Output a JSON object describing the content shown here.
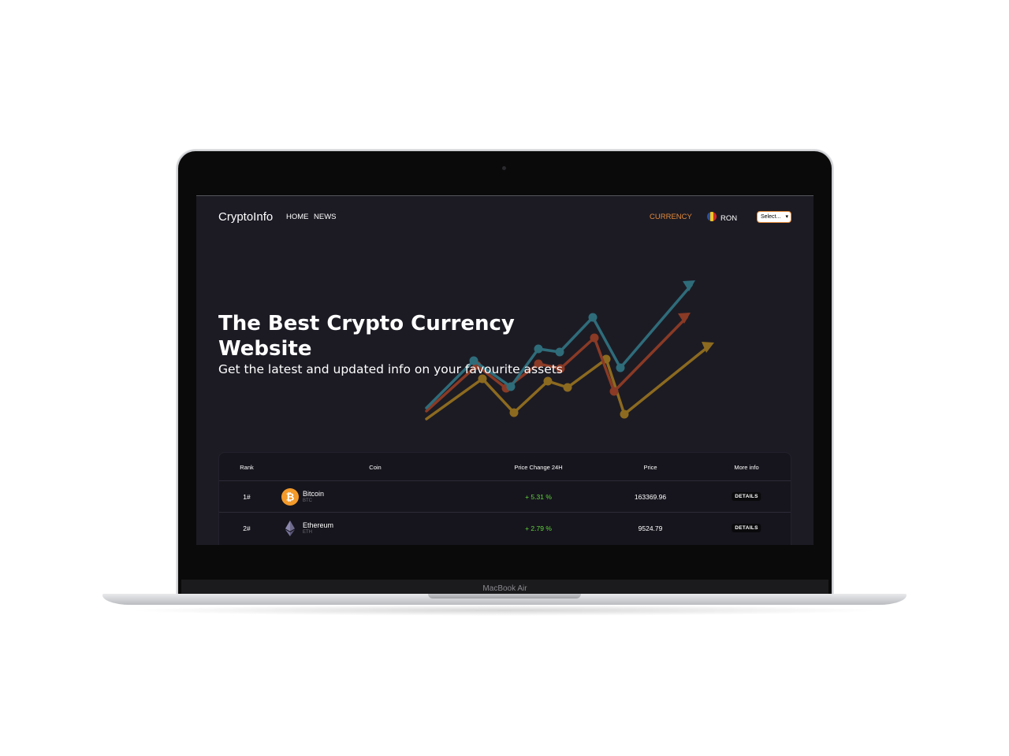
{
  "device": {
    "model_label": "MacBook Air"
  },
  "nav": {
    "brand": "CryptoInfo",
    "links": [
      "HOME",
      "NEWS"
    ],
    "currency_label": "CURRENCY",
    "currency_code": "RON",
    "select_value": "Select..."
  },
  "hero": {
    "title": "The Best Crypto Currency Website",
    "subtitle": "Get the latest and updated info on your favourite assets"
  },
  "table": {
    "headers": [
      "Rank",
      "Coin",
      "Price Change 24H",
      "Price",
      "More info"
    ],
    "rows": [
      {
        "rank": "1#",
        "coin": "Bitcoin",
        "symbol": "BTC",
        "change": "+ 5.31 %",
        "price": "163369.96",
        "action": "DETAILS",
        "icon": "bitcoin-icon"
      },
      {
        "rank": "2#",
        "coin": "Ethereum",
        "symbol": "ETH",
        "change": "+ 2.79 %",
        "price": "9524.79",
        "action": "DETAILS",
        "icon": "ethereum-icon"
      }
    ]
  },
  "colors": {
    "accent": "#e3893a",
    "positive": "#5fd53a",
    "screen_bg": "#1c1b24",
    "line_teal": "#2f6c7a",
    "line_red": "#8a3a25",
    "line_gold": "#8c6a1f",
    "flag_colors": [
      "#2b4fa0",
      "#f3c623",
      "#cc2b2b"
    ]
  }
}
